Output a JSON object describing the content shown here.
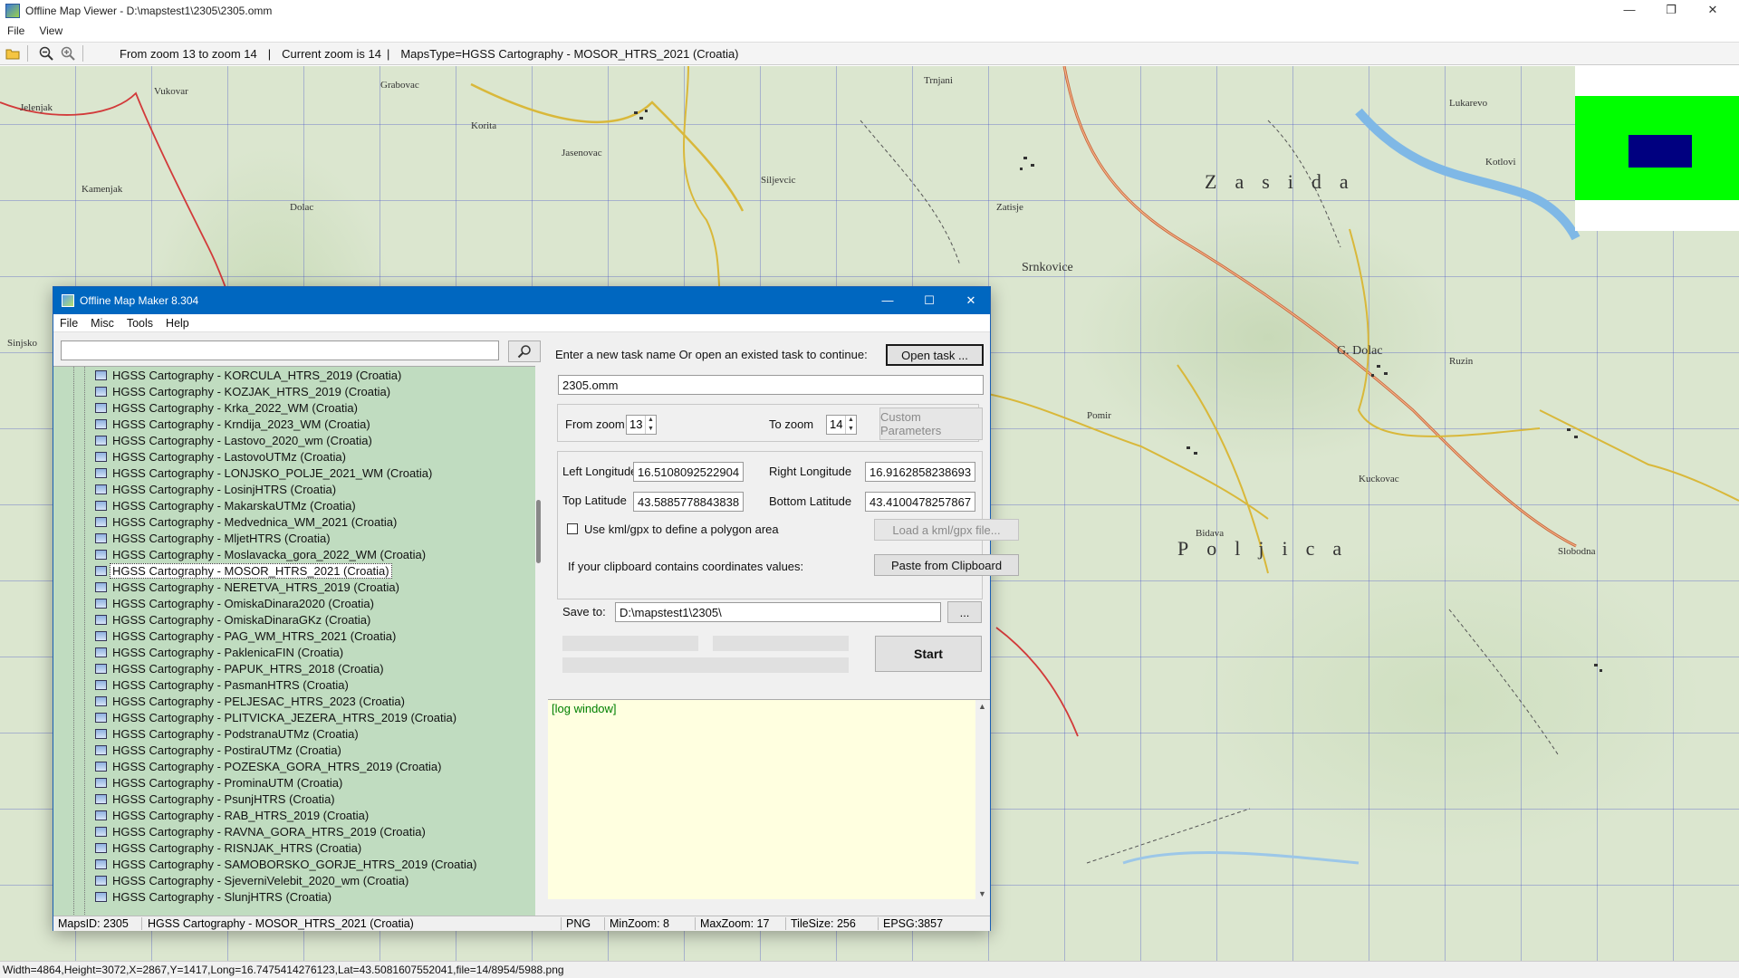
{
  "viewer": {
    "title": "Offline Map Viewer - D:\\mapstest1\\2305\\2305.omm",
    "menu": [
      "File",
      "View"
    ],
    "toolbar": {
      "zoom_range": "From zoom 13 to zoom 14",
      "current_zoom": "Current zoom is 14",
      "maps_type": "MapsType=HGSS Cartography - MOSOR_HTRS_2021 (Croatia)"
    },
    "status": "Width=4864,Height=3072,X=2867,Y=1417,Long=16.7475414276123,Lat=43.5081607552041,file=14/8954/5988.png"
  },
  "map_labels": [
    "Jelenjak",
    "Vukovar",
    "Kamenjak",
    "Dolac",
    "Grabovac",
    "Korita",
    "Jasenovac",
    "Siljevcic",
    "Trnjani",
    "Zatisje",
    "Lukarevo",
    "Kotlovi",
    "Sinjsko",
    "Pomir",
    "Bidava",
    "Kuckovac",
    "Ruzin",
    "Slobodna",
    "Zasida",
    "Srnkovice",
    "G. Dolac",
    "Poljica"
  ],
  "dialog": {
    "title": "Offline Map Maker 8.304",
    "menu": [
      "File",
      "Misc",
      "Tools",
      "Help"
    ],
    "search": {
      "value": "",
      "placeholder": ""
    },
    "tree_items": [
      "HGSS Cartography - KORCULA_HTRS_2019 (Croatia)",
      "HGSS Cartography - KOZJAK_HTRS_2019 (Croatia)",
      "HGSS Cartography - Krka_2022_WM (Croatia)",
      "HGSS Cartography - Krndija_2023_WM (Croatia)",
      "HGSS Cartography - Lastovo_2020_wm (Croatia)",
      "HGSS Cartography - LastovoUTMz (Croatia)",
      "HGSS Cartography - LONJSKO_POLJE_2021_WM (Croatia)",
      "HGSS Cartography - LosinjHTRS (Croatia)",
      "HGSS Cartography - MakarskaUTMz (Croatia)",
      "HGSS Cartography - Medvednica_WM_2021 (Croatia)",
      "HGSS Cartography - MljetHTRS (Croatia)",
      "HGSS Cartography - Moslavacka_gora_2022_WM (Croatia)",
      "HGSS Cartography - MOSOR_HTRS_2021 (Croatia)",
      "HGSS Cartography - NERETVA_HTRS_2019 (Croatia)",
      "HGSS Cartography - OmiskaDinara2020 (Croatia)",
      "HGSS Cartography - OmiskaDinaraGKz (Croatia)",
      "HGSS Cartography - PAG_WM_HTRS_2021 (Croatia)",
      "HGSS Cartography - PaklenicaFIN (Croatia)",
      "HGSS Cartography - PAPUK_HTRS_2018 (Croatia)",
      "HGSS Cartography - PasmanHTRS (Croatia)",
      "HGSS Cartography - PELJESAC_HTRS_2023 (Croatia)",
      "HGSS Cartography - PLITVICKA_JEZERA_HTRS_2019 (Croatia)",
      "HGSS Cartography - PodstranaUTMz (Croatia)",
      "HGSS Cartography - PostiraUTMz (Croatia)",
      "HGSS Cartography - POZESKA_GORA_HTRS_2019 (Croatia)",
      "HGSS Cartography - ProminaUTM (Croatia)",
      "HGSS Cartography - PsunjHTRS (Croatia)",
      "HGSS Cartography - RAB_HTRS_2019 (Croatia)",
      "HGSS Cartography - RAVNA_GORA_HTRS_2019 (Croatia)",
      "HGSS Cartography - RISNJAK_HTRS (Croatia)",
      "HGSS Cartography - SAMOBORSKO_GORJE_HTRS_2019 (Croatia)",
      "HGSS Cartography - SjeverniVelebit_2020_wm (Croatia)",
      "HGSS Cartography - SlunjHTRS (Croatia)"
    ],
    "selected_item": "HGSS Cartography - MOSOR_HTRS_2021 (Croatia)",
    "task_prompt": "Enter a new task name Or open an existed task to continue:",
    "open_task_label": "Open task ...",
    "task_name": "2305.omm",
    "from_zoom_label": "From zoom",
    "from_zoom": "13",
    "to_zoom_label": "To zoom",
    "to_zoom": "14",
    "custom_params_label": "Custom Parameters",
    "left_lon_label": "Left Longitude",
    "left_lon": "16.5108092522904",
    "right_lon_label": "Right Longitude",
    "right_lon": "16.9162858238693",
    "top_lat_label": "Top Latitude",
    "top_lat": "43.5885778843838",
    "bottom_lat_label": "Bottom Latitude",
    "bottom_lat": "43.4100478257867",
    "kml_label": "Use kml/gpx to define a polygon area",
    "load_kml_label": "Load a kml/gpx file...",
    "clipboard_prompt": "If your clipboard contains coordinates values:",
    "paste_label": "Paste from Clipboard",
    "save_to_label": "Save to:",
    "save_to": "D:\\mapstest1\\2305\\",
    "browse_label": "...",
    "start_label": "Start",
    "log_text": "[log window]",
    "status": {
      "maps_id": "MapsID: 2305",
      "maps_name": "HGSS Cartography - MOSOR_HTRS_2021 (Croatia)",
      "format": "PNG",
      "min_zoom": "MinZoom: 8",
      "max_zoom": "MaxZoom: 17",
      "tile_size": "TileSize: 256",
      "epsg": "EPSG:3857"
    }
  },
  "colors": {
    "dialog_title": "#0067c0",
    "tree_bg": "#c0dcc0",
    "log_bg": "#ffffe0",
    "minimap_bg": "#00ff00",
    "minimap_viewport": "#000080"
  }
}
